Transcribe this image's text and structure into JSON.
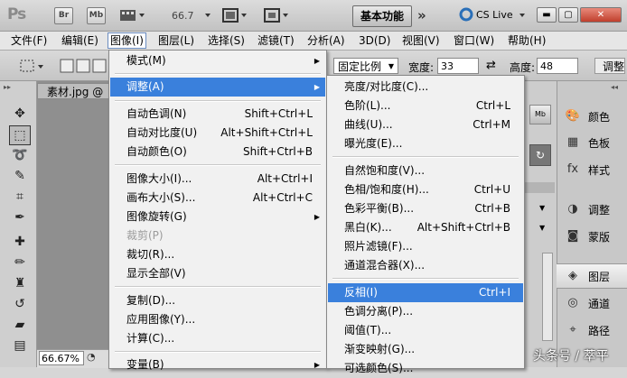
{
  "titlebar": {
    "app_logo": "Ps",
    "br_label": "Br",
    "mb_label": "Mb",
    "zoom": "66.7",
    "workspace": "基本功能",
    "cs_live": "CS Live"
  },
  "menubar": [
    "文件(F)",
    "编辑(E)",
    "图像(I)",
    "图层(L)",
    "选择(S)",
    "滤镜(T)",
    "分析(A)",
    "3D(D)",
    "视图(V)",
    "窗口(W)",
    "帮助(H)"
  ],
  "options": {
    "style_value": "固定比例",
    "width_label": "宽度:",
    "width_value": "33",
    "height_label": "高度:",
    "height_value": "48",
    "adjust_button": "调整"
  },
  "document": {
    "tab": "素材.jpg @",
    "zoom_status": "66.67%"
  },
  "image_menu": [
    {
      "label": "模式(M)",
      "submenu": true
    },
    {
      "label": "调整(A)",
      "submenu": true,
      "highlighted": true
    },
    {
      "label": "自动色调(N)",
      "shortcut": "Shift+Ctrl+L"
    },
    {
      "label": "自动对比度(U)",
      "shortcut": "Alt+Shift+Ctrl+L"
    },
    {
      "label": "自动颜色(O)",
      "shortcut": "Shift+Ctrl+B"
    },
    {
      "label": "图像大小(I)...",
      "shortcut": "Alt+Ctrl+I"
    },
    {
      "label": "画布大小(S)...",
      "shortcut": "Alt+Ctrl+C"
    },
    {
      "label": "图像旋转(G)",
      "submenu": true
    },
    {
      "label": "裁剪(P)",
      "disabled": true
    },
    {
      "label": "裁切(R)..."
    },
    {
      "label": "显示全部(V)"
    },
    {
      "label": "复制(D)..."
    },
    {
      "label": "应用图像(Y)..."
    },
    {
      "label": "计算(C)..."
    },
    {
      "label": "变量(B)",
      "submenu": true
    }
  ],
  "adjust_menu": [
    {
      "label": "亮度/对比度(C)..."
    },
    {
      "label": "色阶(L)...",
      "shortcut": "Ctrl+L"
    },
    {
      "label": "曲线(U)...",
      "shortcut": "Ctrl+M"
    },
    {
      "label": "曝光度(E)..."
    },
    {
      "label": "自然饱和度(V)..."
    },
    {
      "label": "色相/饱和度(H)...",
      "shortcut": "Ctrl+U"
    },
    {
      "label": "色彩平衡(B)...",
      "shortcut": "Ctrl+B"
    },
    {
      "label": "黑白(K)...",
      "shortcut": "Alt+Shift+Ctrl+B"
    },
    {
      "label": "照片滤镜(F)..."
    },
    {
      "label": "通道混合器(X)..."
    },
    {
      "label": "反相(I)",
      "shortcut": "Ctrl+I",
      "highlighted": true
    },
    {
      "label": "色调分离(P)..."
    },
    {
      "label": "阈值(T)..."
    },
    {
      "label": "渐变映射(G)..."
    },
    {
      "label": "可选颜色(S)..."
    }
  ],
  "dock": [
    {
      "label": "颜色",
      "icon": "palette-icon"
    },
    {
      "label": "色板",
      "icon": "swatches-icon"
    },
    {
      "label": "样式",
      "icon": "styles-icon"
    },
    {
      "label": "调整",
      "icon": "adjustments-icon"
    },
    {
      "label": "蒙版",
      "icon": "masks-icon"
    },
    {
      "label": "图层",
      "icon": "layers-icon"
    },
    {
      "label": "通道",
      "icon": "channels-icon"
    },
    {
      "label": "路径",
      "icon": "paths-icon"
    }
  ],
  "watermark": "头条号 / 萃平",
  "colors": {
    "highlight": "#3a80dc",
    "menu_bg": "#f1f1f1",
    "close_button": "#c0402d"
  }
}
